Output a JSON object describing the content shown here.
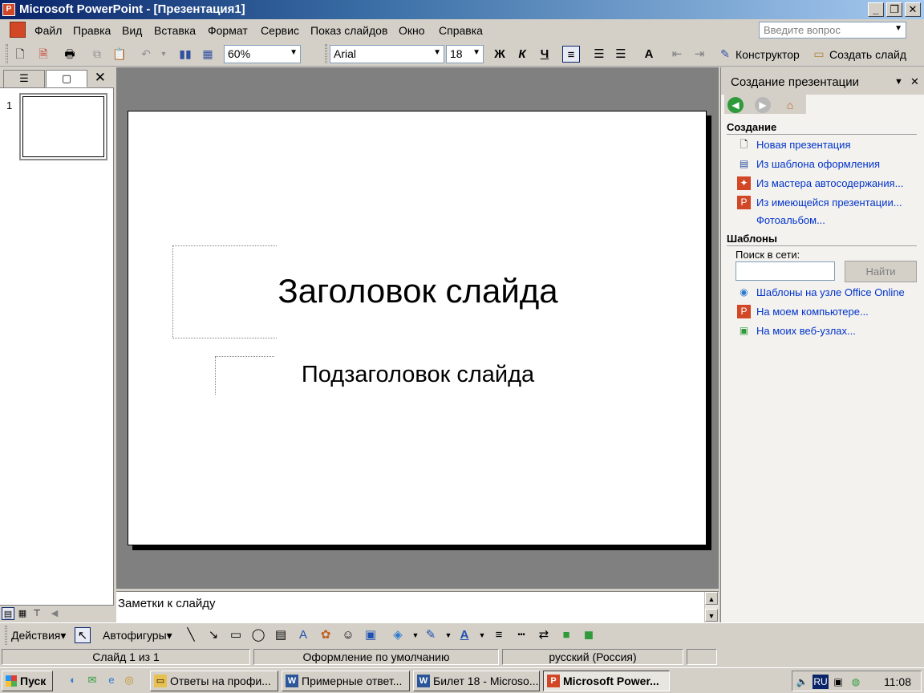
{
  "window": {
    "title": "Microsoft PowerPoint - [Презентация1]",
    "minimize": "_",
    "restore": "❐",
    "close": "✕"
  },
  "menu": {
    "items": [
      "Файл",
      "Правка",
      "Вид",
      "Вставка",
      "Формат",
      "Сервис",
      "Показ слайдов",
      "Окно",
      "Справка"
    ],
    "help_placeholder": "Введите вопрос"
  },
  "toolbar": {
    "zoom": "60%",
    "font": "Arial",
    "font_size": "18",
    "bold": "Ж",
    "italic": "К",
    "underline": "Ч",
    "designer": "Конструктор",
    "new_slide": "Создать слайд"
  },
  "slides_pane": {
    "close": "✕",
    "slide_number": "1"
  },
  "slide": {
    "title": "Заголовок слайда",
    "subtitle": "Подзаголовок слайда"
  },
  "notes": {
    "text": "Заметки к слайду"
  },
  "task_pane": {
    "title": "Создание презентации",
    "sections": {
      "create": "Создание",
      "templates": "Шаблоны"
    },
    "create_links": [
      "Новая презентация",
      "Из шаблона оформления",
      "Из мастера автосодержания...",
      "Из имеющейся презентации...",
      "Фотоальбом..."
    ],
    "search_label": "Поиск в сети:",
    "search_value": "",
    "find_button": "Найти",
    "template_links": [
      "Шаблоны на узле Office Online",
      "На моем компьютере...",
      "На моих веб-узлах..."
    ]
  },
  "drawing": {
    "actions": "Действия",
    "autoshapes": "Автофигуры"
  },
  "status": {
    "slide": "Слайд 1 из 1",
    "design": "Оформление по умолчанию",
    "language": "русский (Россия)"
  },
  "taskbar": {
    "start": "Пуск",
    "buttons": [
      "Ответы на профи...",
      "Примерные ответ...",
      "Билет 18 - Microso...",
      "Microsoft Power..."
    ],
    "lang": "RU",
    "time": "11:08"
  },
  "colors": {
    "title_bar_start": "#0a246a",
    "link": "#0033cc",
    "slide_area": "#808080",
    "chrome": "#d4d0c8",
    "powerpoint_icon": "#d24726"
  }
}
